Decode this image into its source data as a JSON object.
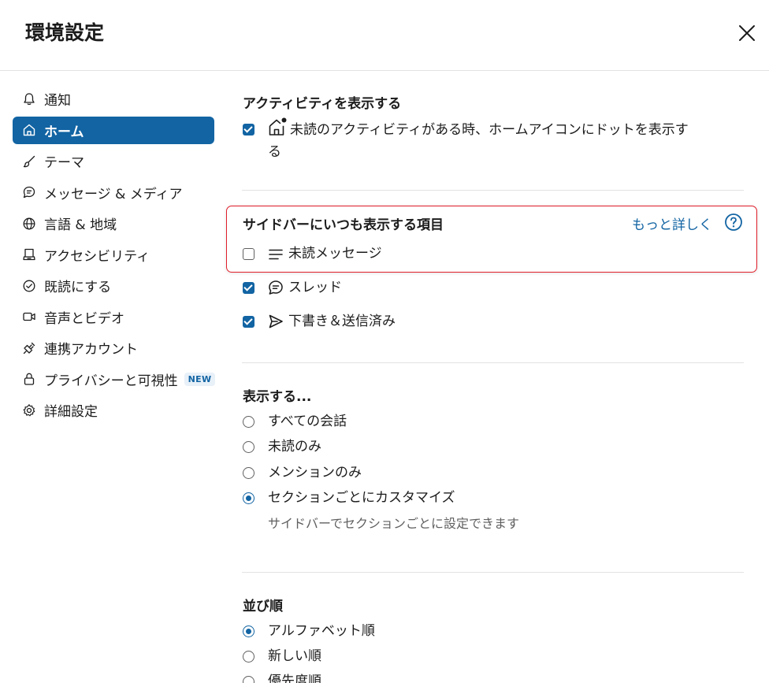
{
  "dialog": {
    "title": "環境設定",
    "close_icon": "close-icon"
  },
  "sidebar": {
    "items": [
      {
        "label": "通知",
        "icon": "bell-icon",
        "active": false
      },
      {
        "label": "ホーム",
        "icon": "home-icon",
        "active": true
      },
      {
        "label": "テーマ",
        "icon": "brush-icon",
        "active": false
      },
      {
        "label": "メッセージ & メディア",
        "icon": "message-icon",
        "active": false
      },
      {
        "label": "言語 & 地域",
        "icon": "globe-icon",
        "active": false
      },
      {
        "label": "アクセシビリティ",
        "icon": "keyboard-icon",
        "active": false
      },
      {
        "label": "既読にする",
        "icon": "check-circle-icon",
        "active": false
      },
      {
        "label": "音声とビデオ",
        "icon": "video-icon",
        "active": false
      },
      {
        "label": "連携アカウント",
        "icon": "plug-icon",
        "active": false
      },
      {
        "label": "プライバシーと可視性",
        "icon": "lock-icon",
        "active": false,
        "badge": "NEW"
      },
      {
        "label": "詳細設定",
        "icon": "gear-icon",
        "active": false
      }
    ]
  },
  "activity": {
    "title": "アクティビティを表示する",
    "option_line1": "未読のアクティビティがある時、ホームアイコンにドットを表示す",
    "option_line2": "る",
    "checked": true
  },
  "sidebar_items_section": {
    "title": "サイドバーにいつも表示する項目",
    "more_link": "もっと詳しく",
    "options": [
      {
        "label": "未読メッセージ",
        "icon": "list-icon",
        "checked": false
      },
      {
        "label": "スレッド",
        "icon": "thread-icon",
        "checked": true
      },
      {
        "label": "下書き＆送信済み",
        "icon": "send-icon",
        "checked": true
      }
    ]
  },
  "show_section": {
    "title": "表示する...",
    "options": [
      {
        "label": "すべての会話",
        "selected": false
      },
      {
        "label": "未読のみ",
        "selected": false
      },
      {
        "label": "メンションのみ",
        "selected": false
      },
      {
        "label": "セクションごとにカスタマイズ",
        "selected": true,
        "description": "サイドバーでセクションごとに設定できます"
      }
    ]
  },
  "sort_section": {
    "title": "並び順",
    "options": [
      {
        "label": "アルファベット順",
        "selected": true
      },
      {
        "label": "新しい順",
        "selected": false
      },
      {
        "label": "優先度順",
        "selected": false
      }
    ]
  },
  "colors": {
    "accent": "#1264a3",
    "highlight_border": "#e01e2a"
  }
}
